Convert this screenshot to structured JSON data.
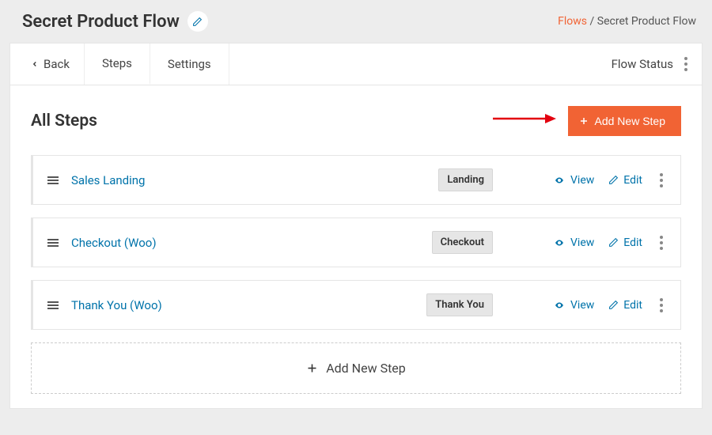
{
  "header": {
    "title": "Secret Product Flow",
    "breadcrumb": {
      "root": "Flows",
      "current": "Secret Product Flow",
      "sep": " / "
    }
  },
  "tabs": {
    "back": "Back",
    "steps": "Steps",
    "settings": "Settings",
    "flow_status": "Flow Status"
  },
  "section": {
    "title": "All Steps",
    "add_button": "Add New Step",
    "add_row": "Add New Step",
    "view_label": "View",
    "edit_label": "Edit"
  },
  "steps": [
    {
      "name": "Sales Landing",
      "badge": "Landing"
    },
    {
      "name": "Checkout (Woo)",
      "badge": "Checkout"
    },
    {
      "name": "Thank You (Woo)",
      "badge": "Thank You"
    }
  ],
  "colors": {
    "accent": "#f16334",
    "link": "#0073aa"
  }
}
